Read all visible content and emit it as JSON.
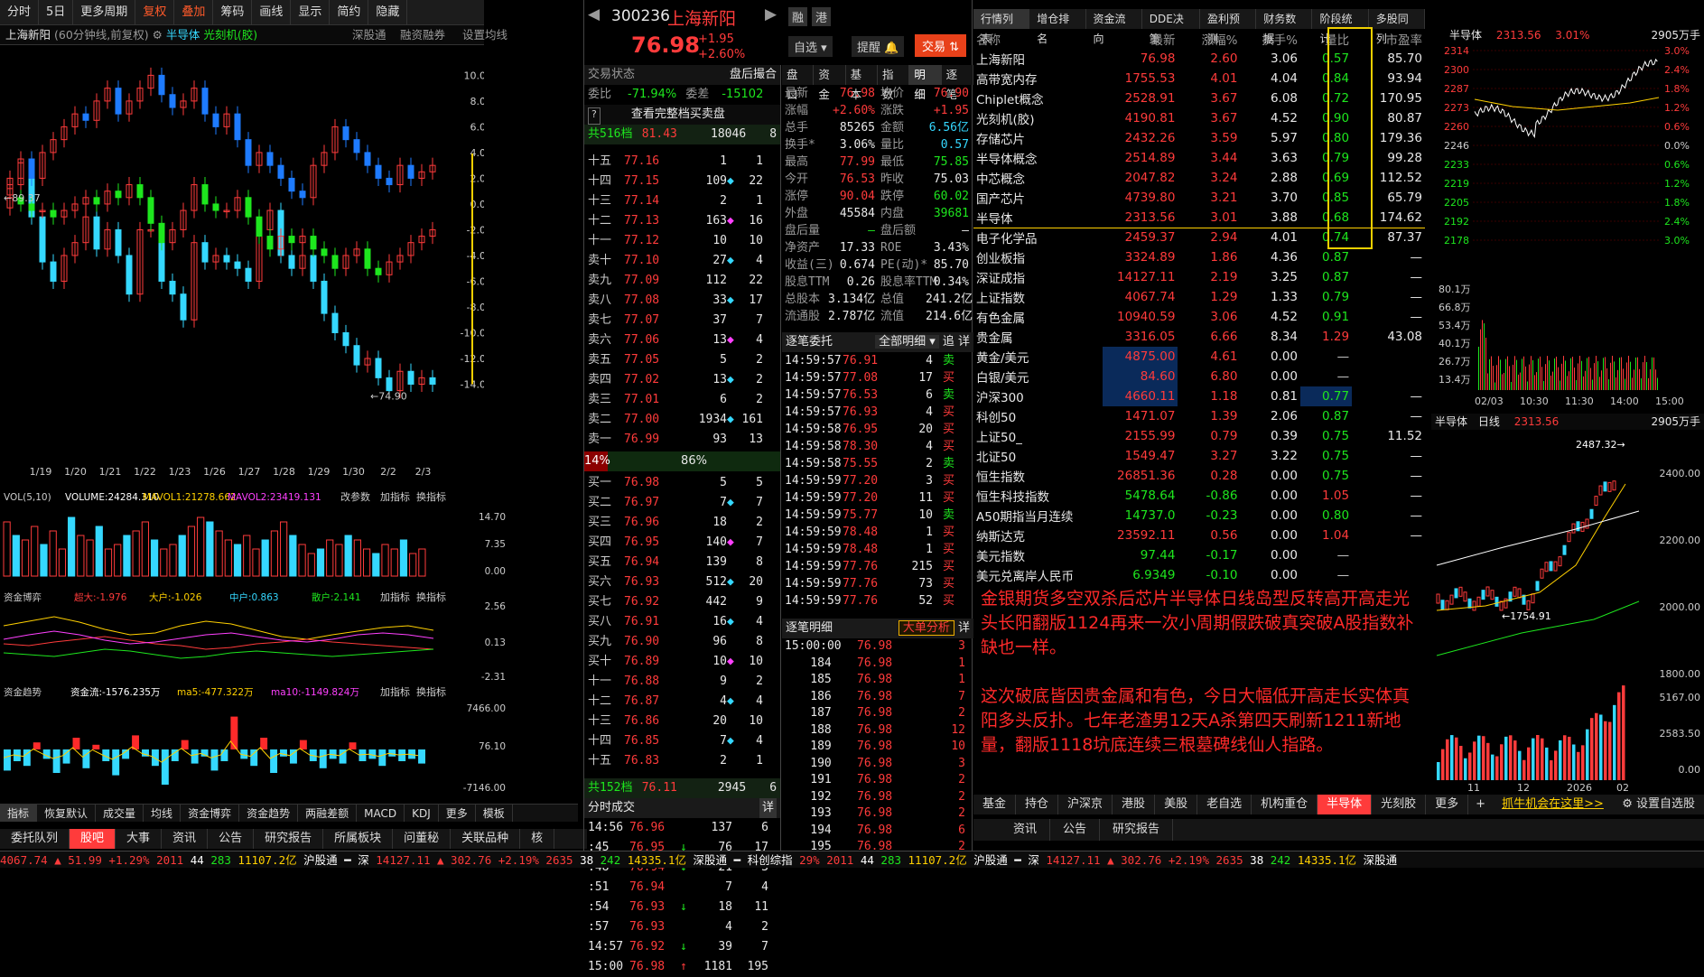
{
  "toolbar": {
    "items": [
      "分时",
      "5日",
      "更多周期",
      "复权",
      "叠加",
      "筹码",
      "画线",
      "显示",
      "简约",
      "隐藏"
    ]
  },
  "chart_header": {
    "stock": "上海新阳",
    "period": "(60分钟线,前复权)",
    "overlay1": "半导体",
    "overlay2": "光刻机(胶)",
    "links": [
      "深股通",
      "融资融券",
      "设置均线"
    ]
  },
  "chart_data": [
    {
      "type": "candlestick",
      "title": "上海新阳 60分钟线 前复权",
      "y_ticks": [
        10.0,
        8.0,
        6.0,
        4.0,
        2.0,
        0.0,
        -2.0,
        -4.0,
        -6.0,
        -8.0,
        -10.0,
        -12.0,
        -14.0
      ],
      "y_tick_labels": [
        "10.00",
        "8.00",
        "6.00",
        "4.00",
        "2.00",
        "0.00",
        "-2.00",
        "-4.00",
        "-6.00",
        "-8.00",
        "-10.00",
        "-12.00",
        "-14.00"
      ],
      "ylim": [
        -16.0,
        11.5
      ],
      "annotations": [
        "89.37",
        "74.90"
      ],
      "x_labels": [
        "1/19",
        "1/20",
        "1/21",
        "1/22",
        "1/23",
        "1/26",
        "1/27",
        "1/28",
        "1/29",
        "1/30",
        "2/2",
        "2/3"
      ],
      "series": [
        {
          "name": "上海新阳",
          "color": "#ff3b3b",
          "values": [
            1.5,
            3.2,
            -1.0,
            -4.5,
            -6.0,
            -4.0,
            -3.0,
            -1.0,
            -3.5,
            -2.0,
            -4.0,
            -7.0,
            -2.0,
            -2.0,
            -6.0,
            -7.0,
            -9.0,
            -3.0,
            -4.5,
            -4.0,
            -4.5,
            -5.0,
            -6.0,
            -2.0,
            -0.5,
            -4.0,
            -5.0,
            -4.0,
            -6.0,
            -8.5,
            -10.0,
            -11.0,
            -12.5,
            -12.0,
            -13.5,
            -14.5,
            -13.0,
            -14.0,
            -13.5,
            -14.0
          ]
        },
        {
          "name": "半导体",
          "color": "#35d8ff",
          "values": [
            2.0,
            3.5,
            2.0,
            4.0,
            5.0,
            6.0,
            7.0,
            6.5,
            8.0,
            9.0,
            7.0,
            8.0,
            9.0,
            10.0,
            8.5,
            7.5,
            8.0,
            9.0,
            7.0,
            6.0,
            7.0,
            5.0,
            3.0,
            4.0,
            3.0,
            2.0,
            1.0,
            0.5,
            3.0,
            4.0,
            6.0,
            5.0,
            4.0,
            3.0,
            2.0,
            1.5,
            3.0,
            2.0,
            2.5,
            3.0
          ]
        },
        {
          "name": "光刻机(胶)",
          "color": "#1ee61e",
          "values": [
            0.5,
            0.0,
            -0.5,
            -0.5,
            -1.0,
            -0.5,
            0.0,
            0.5,
            0.0,
            1.0,
            0.5,
            1.5,
            0.5,
            -1.5,
            -3.0,
            -2.0,
            -0.5,
            1.5,
            0.0,
            -0.5,
            -0.5,
            0.5,
            -1.0,
            -2.5,
            -3.5,
            -2.5,
            -3.0,
            -2.5,
            -3.5,
            -4.0,
            -5.0,
            -4.0,
            -3.5,
            -5.0,
            -5.5,
            -4.5,
            -4.0,
            -3.0,
            -2.5,
            -2.0
          ]
        }
      ]
    },
    {
      "type": "bar",
      "title": "VOL(5,10)",
      "labels": [
        "VOL(5,10)",
        "VOLUME:24284.310",
        "MAVOL1:21278.662",
        "MAVOL2:23419.131"
      ],
      "y_ticks": [
        "14.70",
        "7.35",
        "0.00"
      ],
      "values": [
        12,
        9,
        8,
        11,
        7,
        10,
        6,
        13,
        9,
        8,
        11,
        6,
        7,
        9,
        10,
        12,
        8,
        6,
        7,
        9,
        11,
        13,
        12,
        10,
        8,
        7,
        9,
        6,
        8,
        10,
        12,
        9,
        7,
        5,
        6,
        8,
        7,
        9,
        8,
        6,
        5,
        7,
        6,
        8,
        5,
        6
      ]
    },
    {
      "type": "line",
      "title": "资金博弈",
      "labels": [
        "资金博弈",
        "超大:-1.976",
        "大户:-1.026",
        "中户:0.863",
        "散户:2.141"
      ],
      "y_ticks": [
        "2.56",
        "0.13",
        "-2.31"
      ]
    },
    {
      "type": "bar",
      "title": "资金趋势",
      "labels": [
        "资金趋势",
        "资金流:-1576.235万",
        "ma5:-477.322万",
        "ma10:-1149.824万"
      ],
      "y_ticks": [
        "7466.00",
        "76.10",
        "-7146.00"
      ]
    },
    {
      "type": "line",
      "title": "半导体 分时",
      "y_ticks": [
        "2314",
        "2300",
        "2287",
        "2273",
        "2260",
        "2246",
        "2233",
        "2219",
        "2205",
        "2192",
        "2178"
      ],
      "pct_ticks": [
        "3.0%",
        "2.4%",
        "1.8%",
        "1.2%",
        "0.6%",
        "0.0%",
        "0.6%",
        "1.2%",
        "1.8%",
        "2.4%",
        "3.0%"
      ],
      "x_labels": [
        "02/03",
        "10:30",
        "11:30",
        "14:00",
        "15:00"
      ],
      "vol_ticks": [
        "80.1万",
        "66.8万",
        "53.4万",
        "40.1万",
        "26.7万",
        "13.4万"
      ]
    },
    {
      "type": "candlestick",
      "title": "半导体 日线",
      "y_ticks": [
        "2400.00",
        "2200.00",
        "2000.00",
        "1800.00"
      ],
      "annotations": [
        "2487.32",
        "1754.91"
      ],
      "x_labels": [
        "11",
        "12",
        "2026",
        "02"
      ],
      "vol_ticks": [
        "5167.00",
        "2583.50",
        "0.00"
      ]
    }
  ],
  "chart_tabs": {
    "items": [
      "指标",
      "恢复默认",
      "成交量",
      "均线",
      "资金博弈",
      "资金趋势",
      "两融差额",
      "MACD",
      "KDJ",
      "更多",
      "模板"
    ]
  },
  "quote": {
    "code": "300236",
    "name": "上海新阳",
    "price": "76.98",
    "chg": "+1.95",
    "pct": "+2.60%",
    "buttons": [
      "融",
      "港",
      "自选",
      "提醒",
      "交易"
    ],
    "status_label": "交易状态",
    "status": "盘后撮合",
    "wb_label": "委比",
    "wb": "-71.94%",
    "wc_label": "委差",
    "wc": "-15102",
    "full_book": "查看完整档买卖盘",
    "sell_total": [
      "共516档",
      "81.43",
      "18046",
      "8"
    ],
    "buy_total": [
      "共152档",
      "76.11",
      "2945",
      "6"
    ],
    "ratio": [
      "14%",
      "86%"
    ],
    "sells": [
      [
        "十五",
        "77.16",
        "1",
        "1"
      ],
      [
        "十四",
        "77.15",
        "109",
        "22"
      ],
      [
        "十三",
        "77.14",
        "2",
        "1"
      ],
      [
        "十二",
        "77.13",
        "163",
        "16"
      ],
      [
        "十一",
        "77.12",
        "10",
        "10"
      ],
      [
        "卖十",
        "77.10",
        "27",
        "4"
      ],
      [
        "卖九",
        "77.09",
        "112",
        "22"
      ],
      [
        "卖八",
        "77.08",
        "33",
        "17"
      ],
      [
        "卖七",
        "77.07",
        "37",
        "7"
      ],
      [
        "卖六",
        "77.06",
        "13",
        "4"
      ],
      [
        "卖五",
        "77.05",
        "5",
        "2"
      ],
      [
        "卖四",
        "77.02",
        "13",
        "2"
      ],
      [
        "卖三",
        "77.01",
        "6",
        "2"
      ],
      [
        "卖二",
        "77.00",
        "1934",
        "161"
      ],
      [
        "卖一",
        "76.99",
        "93",
        "13"
      ]
    ],
    "buys": [
      [
        "买一",
        "76.98",
        "5",
        "5"
      ],
      [
        "买二",
        "76.97",
        "7",
        "7"
      ],
      [
        "买三",
        "76.96",
        "18",
        "2"
      ],
      [
        "买四",
        "76.95",
        "140",
        "7"
      ],
      [
        "买五",
        "76.94",
        "139",
        "8"
      ],
      [
        "买六",
        "76.93",
        "512",
        "20"
      ],
      [
        "买七",
        "76.92",
        "442",
        "9"
      ],
      [
        "买八",
        "76.91",
        "16",
        "4"
      ],
      [
        "买九",
        "76.90",
        "96",
        "8"
      ],
      [
        "买十",
        "76.89",
        "10",
        "10"
      ],
      [
        "十一",
        "76.88",
        "9",
        "2"
      ],
      [
        "十二",
        "76.87",
        "4",
        "4"
      ],
      [
        "十三",
        "76.86",
        "20",
        "10"
      ],
      [
        "十四",
        "76.85",
        "7",
        "4"
      ],
      [
        "十五",
        "76.83",
        "2",
        "1"
      ]
    ]
  },
  "tabs2": [
    "盘口",
    "资金",
    "基本",
    "指数",
    "明细",
    "逐笔"
  ],
  "detail": [
    [
      "最新",
      "76.98",
      "均价",
      "76.90"
    ],
    [
      "涨幅",
      "+2.60%",
      "涨跌",
      "+1.95"
    ],
    [
      "总手",
      "85265",
      "金额",
      "6.56亿"
    ],
    [
      "换手*",
      "3.06%",
      "量比",
      "0.57"
    ],
    [
      "最高",
      "77.99",
      "最低",
      "75.85"
    ],
    [
      "今开",
      "76.53",
      "昨收",
      "75.03"
    ],
    [
      "涨停",
      "90.04",
      "跌停",
      "60.02"
    ],
    [
      "外盘",
      "45584",
      "内盘",
      "39681"
    ],
    [
      "盘后量",
      "—",
      "盘后额",
      "—"
    ],
    [
      "净资产",
      "17.33",
      "ROE",
      "3.43%"
    ],
    [
      "收益(三)",
      "0.674",
      "PE(动)*",
      "85.70"
    ],
    [
      "股息TTM",
      "0.26",
      "股息率TTM",
      "0.34%"
    ],
    [
      "总股本",
      "3.134亿",
      "总值",
      "241.2亿"
    ],
    [
      "流通股",
      "2.787亿",
      "流值",
      "214.6亿"
    ]
  ],
  "order_title": "逐笔委托",
  "order_filter": "全部明细",
  "order_btns": [
    "追",
    "详"
  ],
  "orders": [
    [
      "14:59:57",
      "76.91",
      "4",
      "卖"
    ],
    [
      "14:59:57",
      "77.08",
      "17",
      "买"
    ],
    [
      "14:59:57",
      "76.53",
      "6",
      "卖"
    ],
    [
      "14:59:57",
      "76.93",
      "4",
      "买"
    ],
    [
      "14:59:58",
      "76.95",
      "20",
      "买"
    ],
    [
      "14:59:58",
      "78.30",
      "4",
      "买"
    ],
    [
      "14:59:58",
      "75.55",
      "2",
      "卖"
    ],
    [
      "14:59:59",
      "77.20",
      "3",
      "买"
    ],
    [
      "14:59:59",
      "77.20",
      "11",
      "买"
    ],
    [
      "14:59:59",
      "75.77",
      "10",
      "卖"
    ],
    [
      "14:59:59",
      "78.48",
      "1",
      "买"
    ],
    [
      "14:59:59",
      "78.48",
      "1",
      "买"
    ],
    [
      "14:59:59",
      "77.76",
      "215",
      "买"
    ],
    [
      "14:59:59",
      "77.76",
      "73",
      "买"
    ],
    [
      "14:59:59",
      "77.76",
      "52",
      "买"
    ]
  ],
  "tick_title": "逐笔明细",
  "tick_btn": "大单分析",
  "tick_btn2": "详",
  "ticks": [
    [
      "15:00:00",
      "76.98",
      "3"
    ],
    [
      "184",
      "76.98",
      "1"
    ],
    [
      "185",
      "76.98",
      "1"
    ],
    [
      "186",
      "76.98",
      "7"
    ],
    [
      "187",
      "76.98",
      "2"
    ],
    [
      "188",
      "76.98",
      "12"
    ],
    [
      "189",
      "76.98",
      "10"
    ],
    [
      "190",
      "76.98",
      "3"
    ],
    [
      "191",
      "76.98",
      "2"
    ],
    [
      "192",
      "76.98",
      "2"
    ],
    [
      "193",
      "76.98",
      "2"
    ],
    [
      "194",
      "76.98",
      "6"
    ],
    [
      "195",
      "76.98",
      "2"
    ]
  ],
  "fs_title": "分时成交",
  "fs_btn": "详",
  "fs": [
    [
      "14:56",
      "76.96",
      "137",
      "6",
      ""
    ],
    [
      ":45",
      "76.95",
      "76",
      "17",
      "↓"
    ],
    [
      ":48",
      "76.94",
      "21",
      "3",
      "↓"
    ],
    [
      ":51",
      "76.94",
      "7",
      "4",
      ""
    ],
    [
      ":54",
      "76.93",
      "18",
      "11",
      "↓"
    ],
    [
      ":57",
      "76.93",
      "4",
      "2",
      ""
    ],
    [
      "14:57",
      "76.92",
      "39",
      "7",
      "↓"
    ],
    [
      "15:00",
      "76.98",
      "1181",
      "195",
      "↑"
    ]
  ],
  "list_tabs": [
    "行情列表",
    "增仓排名",
    "资金流向",
    "DDE决策",
    "盈利预测",
    "财务数据",
    "阶段统计",
    "多股同列"
  ],
  "list_head": [
    "名称",
    "最新",
    "涨幅%",
    "换手%",
    "量比",
    "市盈率"
  ],
  "list": [
    [
      "上海新阳",
      "76.98",
      "2.60",
      "3.06",
      "0.57",
      "85.70",
      "r"
    ],
    [
      "高带宽内存",
      "1755.53",
      "4.01",
      "4.04",
      "0.84",
      "93.94",
      "r"
    ],
    [
      "Chiplet概念",
      "2528.91",
      "3.67",
      "6.08",
      "0.72",
      "170.95",
      "r"
    ],
    [
      "光刻机(胶)",
      "4190.81",
      "3.67",
      "4.52",
      "0.90",
      "80.87",
      "r"
    ],
    [
      "存储芯片",
      "2432.26",
      "3.59",
      "5.97",
      "0.80",
      "179.36",
      "r"
    ],
    [
      "半导体概念",
      "2514.89",
      "3.44",
      "3.63",
      "0.79",
      "99.28",
      "r"
    ],
    [
      "中芯概念",
      "2047.82",
      "3.24",
      "2.88",
      "0.69",
      "112.52",
      "r"
    ],
    [
      "国产芯片",
      "4739.80",
      "3.21",
      "3.70",
      "0.85",
      "65.79",
      "r"
    ],
    [
      "半导体",
      "2313.56",
      "3.01",
      "3.88",
      "0.68",
      "174.62",
      "r"
    ],
    [
      "电子化学品",
      "2459.37",
      "2.94",
      "4.01",
      "0.74",
      "87.37",
      "r"
    ],
    [
      "创业板指",
      "3324.89",
      "1.86",
      "4.36",
      "0.87",
      "—",
      "r"
    ],
    [
      "深证成指",
      "14127.11",
      "2.19",
      "3.25",
      "0.87",
      "—",
      "r"
    ],
    [
      "上证指数",
      "4067.74",
      "1.29",
      "1.33",
      "0.79",
      "—",
      "r"
    ],
    [
      "有色金属",
      "10940.59",
      "3.06",
      "4.52",
      "0.91",
      "—",
      "r"
    ],
    [
      "贵金属",
      "3316.05",
      "6.66",
      "8.34",
      "1.29",
      "43.08",
      "r"
    ],
    [
      "黄金/美元",
      "4875.00",
      "4.61",
      "0.00",
      "—",
      "",
      "r"
    ],
    [
      "白银/美元",
      "84.60",
      "6.80",
      "0.00",
      "—",
      "",
      "r"
    ],
    [
      "沪深300",
      "4660.11",
      "1.18",
      "0.81",
      "0.77",
      "—",
      "r"
    ],
    [
      "科创50",
      "1471.07",
      "1.39",
      "2.06",
      "0.87",
      "—",
      "r"
    ],
    [
      "上证50_",
      "2155.99",
      "0.79",
      "0.39",
      "0.75",
      "11.52",
      "r"
    ],
    [
      "北证50",
      "1549.47",
      "3.27",
      "3.22",
      "0.75",
      "—",
      "r"
    ],
    [
      "恒生指数",
      "26851.36",
      "0.28",
      "0.00",
      "0.75",
      "—",
      "r"
    ],
    [
      "恒生科技指数",
      "5478.64",
      "-0.86",
      "0.00",
      "1.05",
      "—",
      "g"
    ],
    [
      "A50期指当月连续",
      "14737.0",
      "-0.23",
      "0.00",
      "0.80",
      "—",
      "g"
    ],
    [
      "纳斯达克",
      "23592.11",
      "0.56",
      "0.00",
      "1.04",
      "—",
      "r"
    ],
    [
      "美元指数",
      "97.44",
      "-0.17",
      "0.00",
      "—",
      "",
      "g"
    ],
    [
      "美元兑离岸人民币",
      "6.9349",
      "-0.10",
      "0.00",
      "—",
      "",
      "g"
    ]
  ],
  "note": "金银期货多空双杀后芯片半导体日线岛型反转高开高走光头长阳翻版1124再来一次小周期假跌破真突破A股指数补缺也一样。\n\n这次破底皆因贵金属和有色，今日大幅低开高走长实体真阳多头反扑。七年老渣男12天A杀第四天刷新1211新地量，翻版1118坑底连续三根墓碑线仙人指路。",
  "right_header": {
    "name": "半导体",
    "price": "2313.56",
    "pct": "3.01%",
    "vol": "2905万手"
  },
  "right_header2": {
    "name": "半导体",
    "period": "日线",
    "price": "2313.56",
    "vol": "2905万手"
  },
  "bottom_tabs": [
    "基金",
    "持仓",
    "沪深京",
    "港股",
    "美股",
    "老自选",
    "机构重仓",
    "半导体",
    "光刻胶",
    "更多"
  ],
  "bottom_link": "抓牛机会在这里>>",
  "bottom_settings": "设置自选股",
  "sub_tabs": [
    "资讯",
    "公告",
    "研究报告"
  ],
  "left_bottom_tabs": [
    "委托队列",
    "股吧",
    "大事",
    "资讯",
    "公告",
    "研究报告",
    "所属板块",
    "问董秘",
    "关联品种",
    "核"
  ],
  "status": [
    [
      "4067.74",
      "▲ 51.99 +1.29%",
      "2011",
      "44",
      "283",
      "11107.2亿",
      "沪股通"
    ],
    [
      "深",
      "14127.11",
      "▲ 302.76 +2.19%",
      "2635",
      "38",
      "242",
      "14335.1亿",
      "深股通",
      "科创综指"
    ],
    [
      "29%",
      "2011",
      "44",
      "283",
      "11107.2亿",
      "沪股通"
    ],
    [
      "深",
      "14127.11",
      "▲ 302.76 +2.19%",
      "2635",
      "38",
      "242",
      "14335.1亿",
      "深股通"
    ]
  ]
}
